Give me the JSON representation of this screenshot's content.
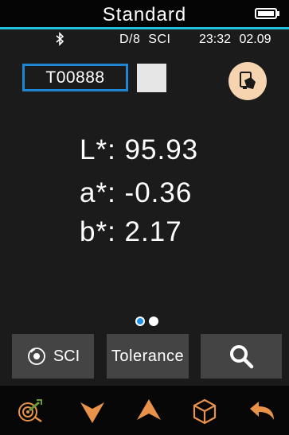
{
  "title_bar": {
    "title": "Standard",
    "icon": "battery-full-icon"
  },
  "status_bar": {
    "icon": "bluetooth-icon",
    "mode": "D/8  SCI",
    "time": "23:32",
    "date": "02.09"
  },
  "sample": {
    "name": "T00888",
    "swatch_color": "#e6e6e6",
    "action_icon": "measure-icon"
  },
  "values": {
    "L_label": "L*:",
    "L_value": "95.93",
    "a_label": "a*:",
    "a_value": "-0.36",
    "b_label": "b*:",
    "b_value": "2.17"
  },
  "pager": {
    "pages": 2,
    "active": 1
  },
  "buttons": {
    "sci_label": "SCI",
    "tolerance_label": "Tolerance",
    "search_icon": "search-icon"
  },
  "nav_icons": [
    "target-icon",
    "chevron-down-icon",
    "chevron-up-icon",
    "cube-icon",
    "back-arrow-icon"
  ],
  "colors": {
    "accent": "#1ec2e0",
    "selection_border": "#1f86d4",
    "nav_icon": "#e8924a",
    "button_bg": "#444444"
  }
}
